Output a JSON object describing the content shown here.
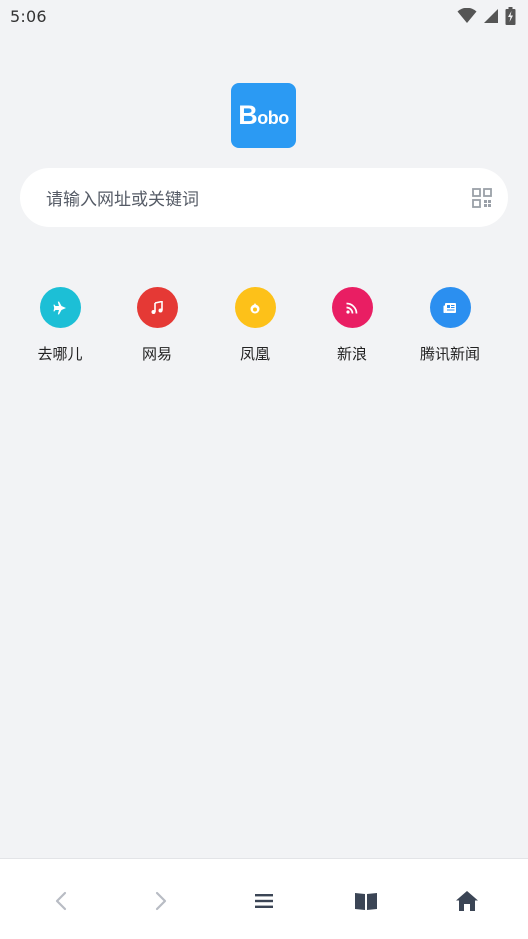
{
  "status_bar": {
    "time": "5:06",
    "icons": [
      "wifi-icon",
      "cellular-signal-icon",
      "battery-charging-icon"
    ]
  },
  "logo": {
    "text_first": "B",
    "text_rest": "obo",
    "color": "#2b9af3"
  },
  "search": {
    "placeholder": "请输入网址或关键词",
    "scan_icon": "qr-scan-icon"
  },
  "quick_links": [
    {
      "label": "去哪儿",
      "icon": "airplane-icon",
      "color": "#1cbfd6"
    },
    {
      "label": "网易",
      "icon": "music-note-icon",
      "color": "#e53935"
    },
    {
      "label": "凤凰",
      "icon": "phoenix-icon",
      "color": "#fdc119"
    },
    {
      "label": "新浪",
      "icon": "rss-icon",
      "color": "#e91e63"
    },
    {
      "label": "腾讯新闻",
      "icon": "newspaper-icon",
      "color": "#2b8ff0"
    }
  ],
  "bottom_nav": {
    "items": [
      "back-icon",
      "forward-icon",
      "menu-icon",
      "book-icon",
      "home-icon"
    ],
    "disabled_color": "#b8bcc4",
    "active_color": "#3b4555"
  }
}
